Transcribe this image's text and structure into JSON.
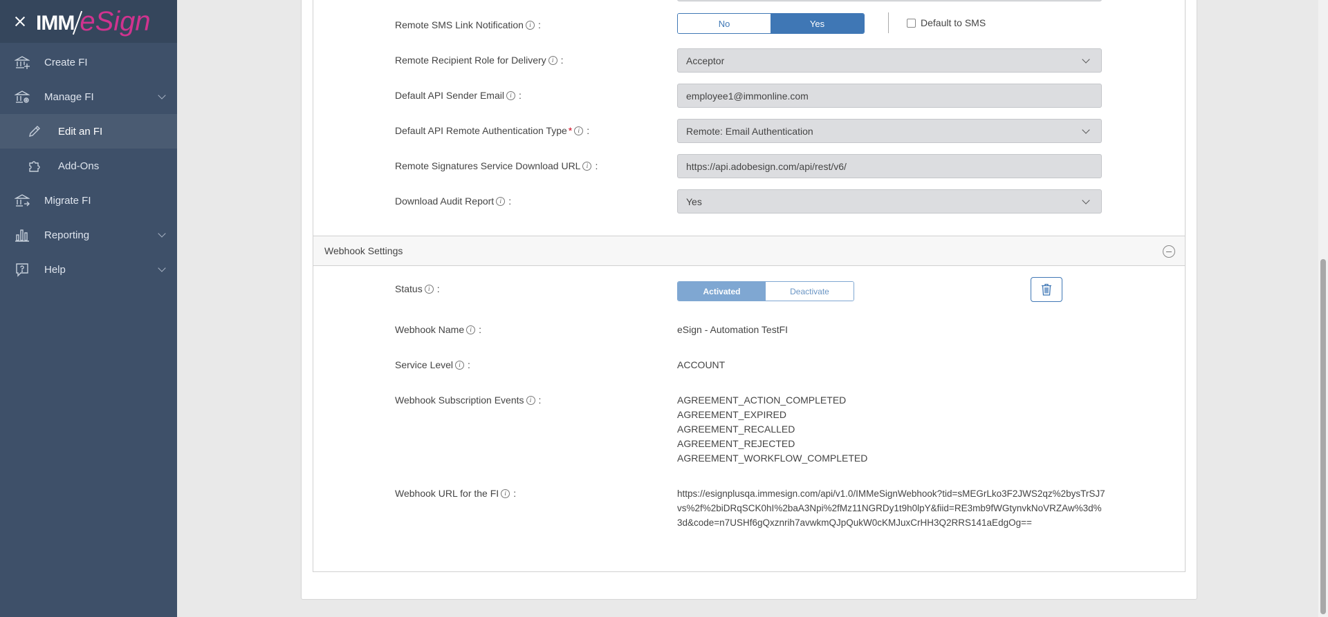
{
  "app": {
    "logo_left": "IMM",
    "logo_right": "eSign"
  },
  "sidebar": {
    "items": [
      {
        "label": "Create FI",
        "icon": "bank-icon"
      },
      {
        "label": "Manage FI",
        "icon": "bank-gear-icon"
      },
      {
        "label": "Edit an FI",
        "icon": "pencil-icon"
      },
      {
        "label": "Add-Ons",
        "icon": "puzzle-icon"
      },
      {
        "label": "Migrate FI",
        "icon": "bank-arrow-icon"
      },
      {
        "label": "Reporting",
        "icon": "bar-chart-icon"
      },
      {
        "label": "Help",
        "icon": "help-icon"
      }
    ]
  },
  "remote_settings": {
    "sms_link": {
      "label": "Remote SMS Link Notification",
      "options": [
        "No",
        "Yes"
      ],
      "selected": "Yes",
      "default_to_sms_label": "Default to SMS"
    },
    "recipient_role": {
      "label": "Remote Recipient Role for Delivery",
      "value": "Acceptor"
    },
    "sender_email": {
      "label": "Default API Sender Email",
      "value": "employee1@immonline.com"
    },
    "auth_type": {
      "label": "Default API Remote Authentication Type",
      "required_mark": "*",
      "value": "Remote: Email Authentication"
    },
    "download_url": {
      "label": "Remote Signatures Service Download URL",
      "value": "https://api.adobesign.com/api/rest/v6/"
    },
    "audit_report": {
      "label": "Download Audit Report",
      "value": "Yes"
    }
  },
  "webhook": {
    "title": "Webhook Settings",
    "status": {
      "label": "Status",
      "options": [
        "Activated",
        "Deactivate"
      ],
      "selected": "Activated"
    },
    "name": {
      "label": "Webhook Name",
      "value": "eSign - Automation TestFI"
    },
    "service_level": {
      "label": "Service Level",
      "value": "ACCOUNT"
    },
    "events": {
      "label": "Webhook Subscription Events",
      "values": [
        "AGREEMENT_ACTION_COMPLETED",
        "AGREEMENT_EXPIRED",
        "AGREEMENT_RECALLED",
        "AGREEMENT_REJECTED",
        "AGREEMENT_WORKFLOW_COMPLETED"
      ]
    },
    "url": {
      "label": "Webhook URL for the FI",
      "value": "https://esignplusqa.immesign.com/api/v1.0/IMMeSignWebhook?tid=sMEGrLko3F2JWS2qz%2bysTrSJ7vs%2f%2biDRqSCK0hI%2baA3Npi%2fMz11NGRDy1t9h0lpY&fiid=RE3mb9fWGtynvkNoVRZAw%3d%3d&code=n7USHf6gQxznrih7avwkmQJpQukW0cKMJuxCrHH3Q2RRS141aEdgOg=="
    }
  },
  "colors": {
    "sidebar": "#3e5069",
    "primary": "#3f77b5",
    "logo_accent": "#d0338f"
  }
}
